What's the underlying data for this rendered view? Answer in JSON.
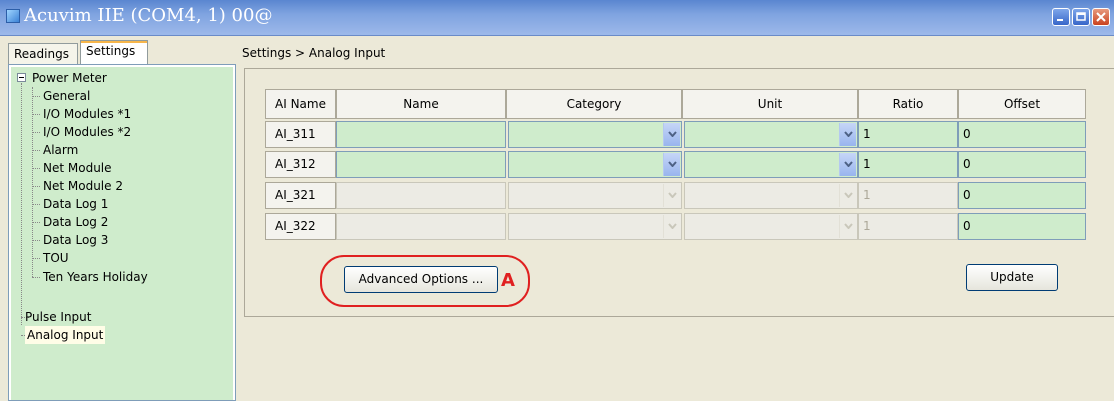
{
  "window": {
    "title": "Acuvim IIE (COM4, 1) 00@"
  },
  "tabs": [
    {
      "label": "Readings"
    },
    {
      "label": "Settings"
    }
  ],
  "tree": {
    "root": "Power Meter",
    "children": [
      "General",
      "I/O Modules *1",
      "I/O Modules *2",
      "Alarm",
      "Net Module",
      "Net Module 2",
      "Data Log 1",
      "Data Log 2",
      "Data Log 3",
      "TOU",
      "Ten Years Holiday"
    ],
    "siblings": [
      "Pulse Input",
      "Analog Input"
    ]
  },
  "breadcrumb": "Settings > Analog Input",
  "table": {
    "headers": [
      "AI Name",
      "Name",
      "Category",
      "Unit",
      "Ratio",
      "Offset"
    ],
    "rows": [
      {
        "ai_name": "AI_311",
        "name": "",
        "category": "",
        "unit": "",
        "ratio": "1",
        "offset": "0"
      },
      {
        "ai_name": "AI_312",
        "name": "",
        "category": "",
        "unit": "",
        "ratio": "1",
        "offset": "0"
      },
      {
        "ai_name": "AI_321",
        "name": "",
        "category": "",
        "unit": "",
        "ratio": "1",
        "offset": "0"
      },
      {
        "ai_name": "AI_322",
        "name": "",
        "category": "",
        "unit": "",
        "ratio": "1",
        "offset": "0"
      }
    ]
  },
  "buttons": {
    "advanced": "Advanced Options ...",
    "update": "Update"
  },
  "annotation": {
    "marker": "A",
    "color": "#e02020"
  },
  "colors": {
    "field_bg": "#cfeccc",
    "titlebar": "#7fa3e0"
  }
}
